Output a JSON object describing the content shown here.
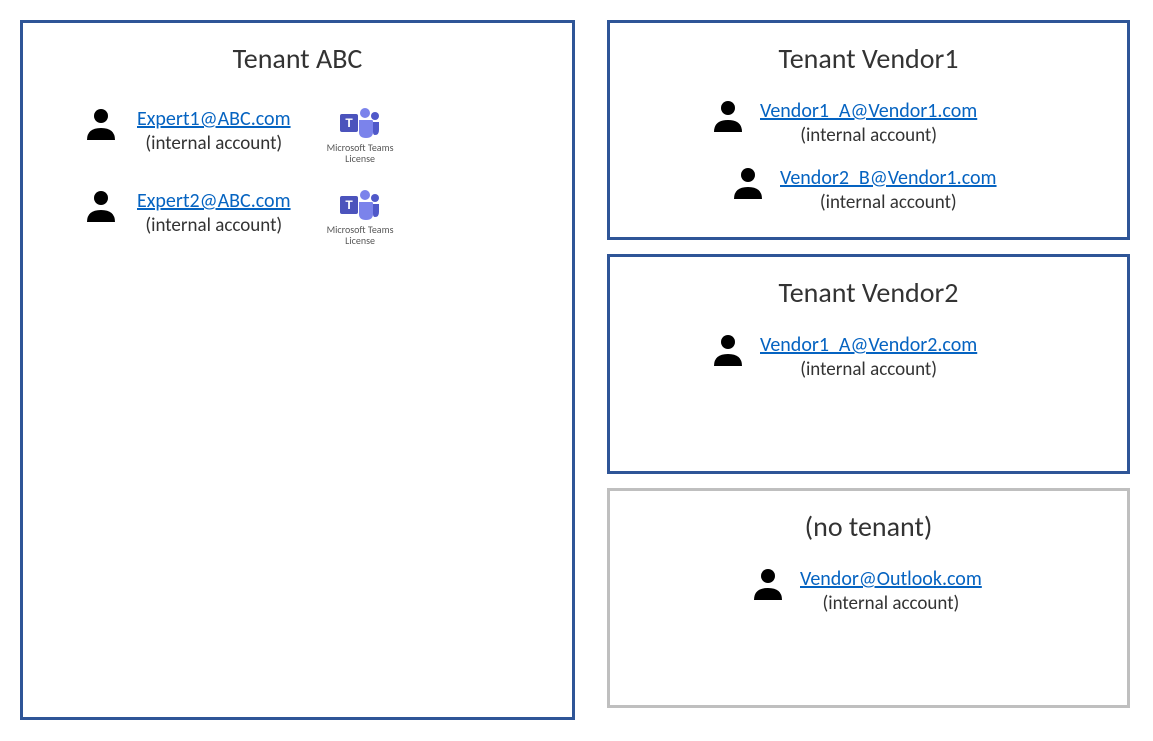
{
  "left_tenant": {
    "title": "Tenant ABC",
    "members": [
      {
        "email": "Expert1@ABC.com",
        "note": "(internal account)",
        "teams_label": "Microsoft Teams\nLicense"
      },
      {
        "email": "Expert2@ABC.com",
        "note": "(internal account)",
        "teams_label": "Microsoft Teams\nLicense"
      }
    ]
  },
  "right_tenants": [
    {
      "title": "Tenant Vendor1",
      "border": "blue",
      "members": [
        {
          "email": "Vendor1_A@Vendor1.com",
          "note": "(internal account)"
        },
        {
          "email": "Vendor2_B@Vendor1.com",
          "note": "(internal account)"
        }
      ]
    },
    {
      "title": "Tenant Vendor2",
      "border": "blue",
      "members": [
        {
          "email": "Vendor1_A@Vendor2.com",
          "note": "(internal account)"
        }
      ]
    },
    {
      "title": "(no tenant)",
      "border": "gray",
      "members": [
        {
          "email": "Vendor@Outlook.com",
          "note": "(internal account)"
        }
      ]
    }
  ],
  "colors": {
    "border_blue": "#2f5597",
    "border_gray": "#bfbfbf",
    "link": "#0563c1",
    "teams_purple": "#5059c9"
  }
}
